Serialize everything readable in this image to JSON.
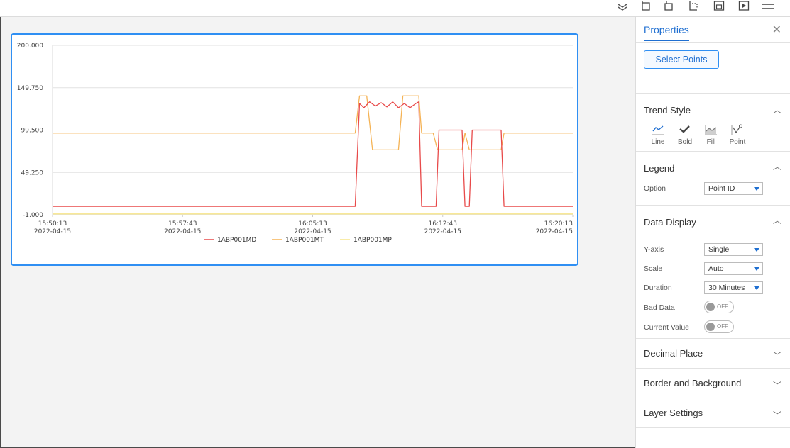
{
  "toolbar": {
    "icons": [
      "layers-icon",
      "align-left-icon",
      "align-center-icon",
      "align-right-icon",
      "frame-icon",
      "preview-icon",
      "menu-icon"
    ]
  },
  "chart_data": {
    "type": "line",
    "title": "",
    "ylim": [
      -1.0,
      200.0
    ],
    "y_ticks": [
      "200.000",
      "149.750",
      "99.500",
      "49.250",
      "-1.000"
    ],
    "x_ticks": [
      {
        "time": "15:50:13",
        "date": "2022-04-15"
      },
      {
        "time": "15:57:43",
        "date": "2022-04-15"
      },
      {
        "time": "16:05:13",
        "date": "2022-04-15"
      },
      {
        "time": "16:12:43",
        "date": "2022-04-15"
      },
      {
        "time": "16:20:13",
        "date": "2022-04-15"
      }
    ],
    "x_range": [
      "15:50:13",
      "16:20:13"
    ],
    "grid": "horizontal",
    "legend_position": "bottom",
    "series": [
      {
        "name": "1ABP001MD",
        "color": "#e84a4a",
        "points": [
          [
            "15:50:13",
            9
          ],
          [
            "16:07:40",
            9
          ],
          [
            "16:07:55",
            131
          ],
          [
            "16:08:10",
            126
          ],
          [
            "16:08:30",
            133
          ],
          [
            "16:08:50",
            128
          ],
          [
            "16:09:10",
            132
          ],
          [
            "16:09:30",
            127
          ],
          [
            "16:09:50",
            133
          ],
          [
            "16:10:10",
            126
          ],
          [
            "16:10:30",
            131
          ],
          [
            "16:10:50",
            126
          ],
          [
            "16:11:10",
            131
          ],
          [
            "16:11:20",
            133
          ],
          [
            "16:11:30",
            9
          ],
          [
            "16:12:20",
            9
          ],
          [
            "16:12:30",
            99.5
          ],
          [
            "16:13:50",
            99.5
          ],
          [
            "16:14:00",
            9
          ],
          [
            "16:14:15",
            9
          ],
          [
            "16:14:25",
            99.5
          ],
          [
            "16:16:05",
            99.5
          ],
          [
            "16:16:15",
            9
          ],
          [
            "16:20:13",
            9
          ]
        ]
      },
      {
        "name": "1ABP001MT",
        "color": "#f5b355",
        "points": [
          [
            "15:50:13",
            96
          ],
          [
            "16:07:40",
            96
          ],
          [
            "16:07:55",
            140
          ],
          [
            "16:08:20",
            140
          ],
          [
            "16:08:40",
            76
          ],
          [
            "16:10:10",
            76
          ],
          [
            "16:10:25",
            140
          ],
          [
            "16:11:20",
            140
          ],
          [
            "16:11:30",
            96
          ],
          [
            "16:12:10",
            96
          ],
          [
            "16:12:25",
            76
          ],
          [
            "16:13:50",
            76
          ],
          [
            "16:14:00",
            96
          ],
          [
            "16:14:15",
            76
          ],
          [
            "16:16:05",
            76
          ],
          [
            "16:16:15",
            96
          ],
          [
            "16:20:13",
            96
          ]
        ]
      },
      {
        "name": "1ABP001MP",
        "color": "#f7e58a",
        "points": [
          [
            "15:50:13",
            0
          ],
          [
            "16:20:13",
            0
          ]
        ]
      }
    ]
  },
  "panel": {
    "title": "Properties",
    "close_glyph": "✕",
    "select_points_label": "Select Points",
    "trend_style": {
      "title": "Trend Style",
      "options": [
        {
          "label": "Line",
          "icon": "line-style-icon",
          "selected": true
        },
        {
          "label": "Bold",
          "icon": "bold-style-icon",
          "selected": false
        },
        {
          "label": "Fill",
          "icon": "fill-style-icon",
          "selected": false
        },
        {
          "label": "Point",
          "icon": "point-style-icon",
          "selected": false
        }
      ]
    },
    "legend": {
      "title": "Legend",
      "option_label": "Option",
      "option_value": "Point ID"
    },
    "data_display": {
      "title": "Data Display",
      "yaxis_label": "Y-axis",
      "yaxis_value": "Single",
      "scale_label": "Scale",
      "scale_value": "Auto",
      "duration_label": "Duration",
      "duration_value": "30 Minutes",
      "bad_data_label": "Bad Data",
      "bad_data_value": "OFF",
      "current_value_label": "Current Value",
      "current_value_value": "OFF"
    },
    "decimal_place": {
      "title": "Decimal Place"
    },
    "border_bg": {
      "title": "Border and Background"
    },
    "layer_settings": {
      "title": "Layer Settings"
    },
    "accent_color": "#1f6fd1"
  }
}
